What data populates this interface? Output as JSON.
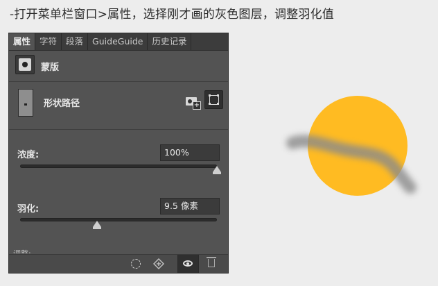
{
  "instruction": "-打开菜单栏窗口>属性，选择刚才画的灰色图层，调整羽化值",
  "panel": {
    "tabs": [
      {
        "label": "属性",
        "active": true
      },
      {
        "label": "字符",
        "active": false
      },
      {
        "label": "段落",
        "active": false
      },
      {
        "label": "GuideGuide",
        "active": false
      },
      {
        "label": "历史记录",
        "active": false
      }
    ],
    "mask_label": "蒙版",
    "shape_label": "形状路径",
    "density": {
      "label": "浓度:",
      "value": "100%",
      "level": 1.0
    },
    "feather": {
      "label": "羽化:",
      "value": "9.5 像素",
      "level": 0.39
    },
    "cut_off_label": "调整:"
  },
  "colors": {
    "panel_bg": "#535353",
    "tab_bg": "#3c3c3c",
    "circle": "#ffbb22",
    "gray_stroke": "#8a8a8a",
    "page_bg": "#ededed"
  },
  "icons": [
    "mask-thumbnail-icon",
    "shape-thumbnail-icon",
    "add-pixel-mask-icon",
    "add-vector-mask-icon",
    "load-selection-icon",
    "apply-mask-icon",
    "eye-icon",
    "trash-icon"
  ]
}
